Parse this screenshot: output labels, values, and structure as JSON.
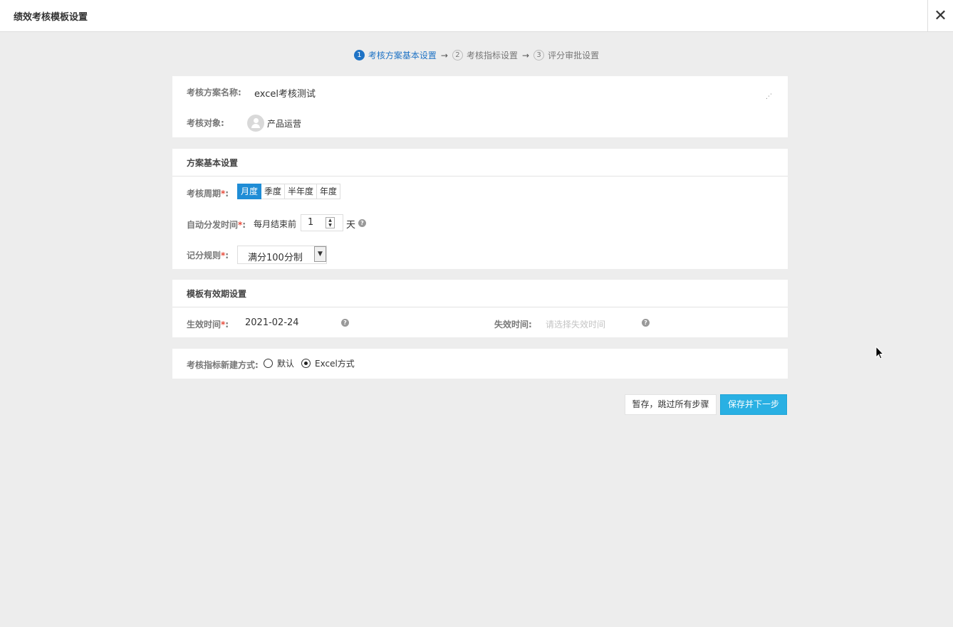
{
  "header": {
    "title": "绩效考核模板设置",
    "close_glyph": "✕"
  },
  "steps": [
    {
      "num": "1",
      "label": "考核方案基本设置"
    },
    {
      "num": "2",
      "label": "考核指标设置"
    },
    {
      "num": "3",
      "label": "评分审批设置"
    }
  ],
  "step_arrow": "→",
  "basic": {
    "name_label": "考核方案名称:",
    "name_value": "excel考核测试",
    "target_label": "考核对象:",
    "target_value": "产品运营"
  },
  "plan": {
    "title": "方案基本设置",
    "cycle_label": "考核周期",
    "cycle_options": [
      "月度",
      "季度",
      "半年度",
      "年度"
    ],
    "cycle_selected": "月度",
    "auto_label": "自动分发时间",
    "auto_prefix": "每月结束前",
    "auto_value": "1",
    "auto_unit": "天",
    "score_label": "记分规则",
    "score_value": "满分100分制"
  },
  "validity": {
    "title": "模板有效期设置",
    "start_label": "生效时间",
    "start_value": "2021-02-24",
    "end_label": "失效时间:",
    "end_placeholder": "请选择失效时间"
  },
  "indicator": {
    "label": "考核指标新建方式:",
    "options": [
      "默认",
      "Excel方式"
    ],
    "selected": "Excel方式"
  },
  "actions": {
    "save_draft": "暂存，跳过所有步骤",
    "save_next": "保存并下一步"
  },
  "required_mark": "*",
  "colon": ":",
  "colors": {
    "accent": "#1f8dd6",
    "primary_button": "#29b0e3",
    "required": "#e74c3c"
  }
}
